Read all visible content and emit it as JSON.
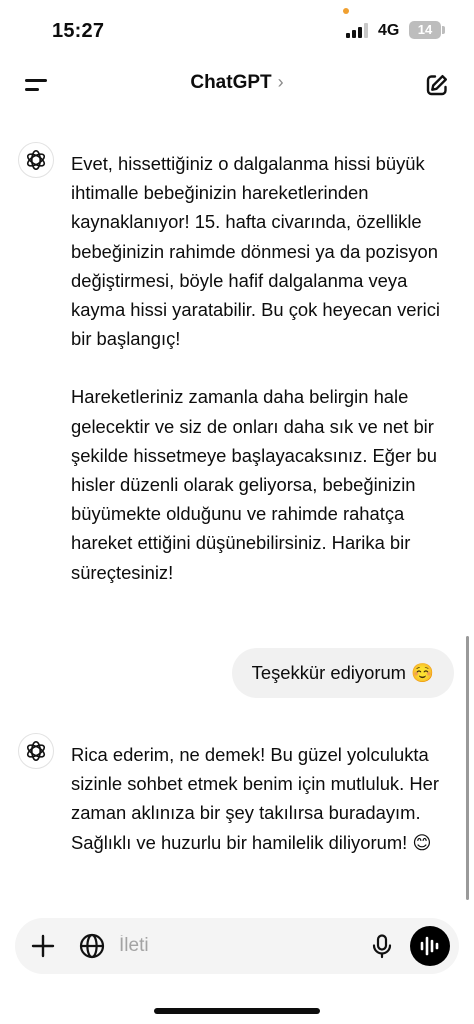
{
  "status_bar": {
    "time": "15:27",
    "network": "4G",
    "battery": "14"
  },
  "header": {
    "title": "ChatGPT",
    "title_chevron": "›"
  },
  "messages": [
    {
      "role": "assistant",
      "paragraphs": [
        "Evet, hissettiğiniz o dalgalanma hissi büyük ihtimalle bebeğinizin hareketlerinden kaynaklanıyor! 15. hafta civarında, özellikle bebeğinizin rahimde dönmesi ya da pozisyon değiştirmesi, böyle hafif dalgalanma veya kayma hissi yaratabilir. Bu çok heyecan verici bir başlangıç!",
        "Hareketleriniz zamanla daha belirgin hale gelecektir ve siz de onları daha sık ve net bir şekilde hissetmeye başlayacaksınız. Eğer bu hisler düzenli olarak geliyorsa, bebeğinizin büyümekte olduğunu ve rahimde rahatça hareket ettiğini düşünebilirsiniz. Harika bir süreçtesiniz!"
      ]
    },
    {
      "role": "user",
      "text": "Teşekkür ediyorum ☺️"
    },
    {
      "role": "assistant",
      "paragraphs": [
        "Rica ederim, ne demek! Bu güzel yolculukta sizinle sohbet etmek benim için mutluluk. Her zaman aklınıza bir şey takılırsa buradayım. Sağlıklı ve huzurlu bir hamilelik diliyorum! 😊"
      ]
    }
  ],
  "composer": {
    "placeholder": "İleti",
    "value": ""
  },
  "icons": {
    "menu": "menu-icon",
    "edit": "new-chat-edit-icon",
    "avatar": "chatgpt-logo-icon",
    "plus": "plus-icon",
    "globe": "globe-icon",
    "mic": "microphone-icon",
    "voice": "voice-waveform-icon"
  },
  "colors": {
    "background": "#ffffff",
    "text": "#0d0d0d",
    "user_bubble": "#f1f1f1",
    "composer": "#f4f4f4",
    "placeholder": "#a3a3a3",
    "status_dot": "#f0a030"
  }
}
